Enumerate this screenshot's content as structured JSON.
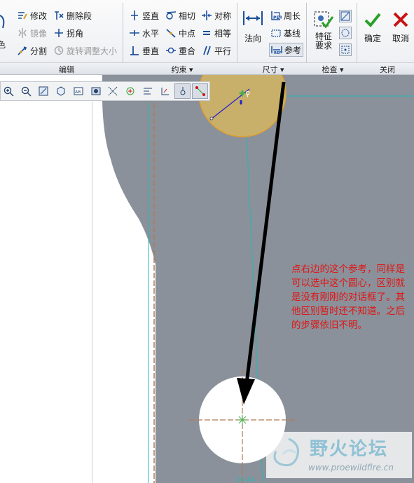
{
  "ribbon": {
    "edit": {
      "modify": "修改",
      "delete_segment": "删除段",
      "mirror": "镜像",
      "corner": "拐角",
      "divide": "分割",
      "rotate_resize": "旋转调整大小",
      "group_label": "编辑"
    },
    "constrain": {
      "vertical": "竖直",
      "tangent": "相切",
      "symmetric": "对称",
      "horizontal": "水平",
      "midpoint": "中点",
      "equal": "相等",
      "perpendicular": "垂直",
      "coincident": "重合",
      "parallel": "平行",
      "group_label": "约束 ▾"
    },
    "dimension": {
      "normal": "法向",
      "perimeter": "周长",
      "baseline": "基线",
      "reference": "参考",
      "group_label": "尺寸 ▾"
    },
    "inspect": {
      "feature_req_line1": "特征",
      "feature_req_line2": "要求",
      "group_label": "检查 ▾"
    },
    "close": {
      "ok": "确定",
      "cancel": "取消",
      "group_label": "关闭"
    }
  },
  "annotation_text": "点右边的这个参考，同样是可以选中这个圆心，区别就是没有刚刚的对话框了。其他区别暂时还不知道。之后的步骤依旧不明。",
  "watermark": {
    "title": "野火论坛",
    "url": "www.proewildfire.cn"
  },
  "colors": {
    "sketch_gray": "#8a919a",
    "circle_fill": "#c9b06a",
    "circle_stroke": "#e0a030",
    "construction_line": "#2bb5b5",
    "center_line": "#b07b55",
    "annotation_red": "#e01515",
    "accent_blue": "#1b4f9c"
  }
}
